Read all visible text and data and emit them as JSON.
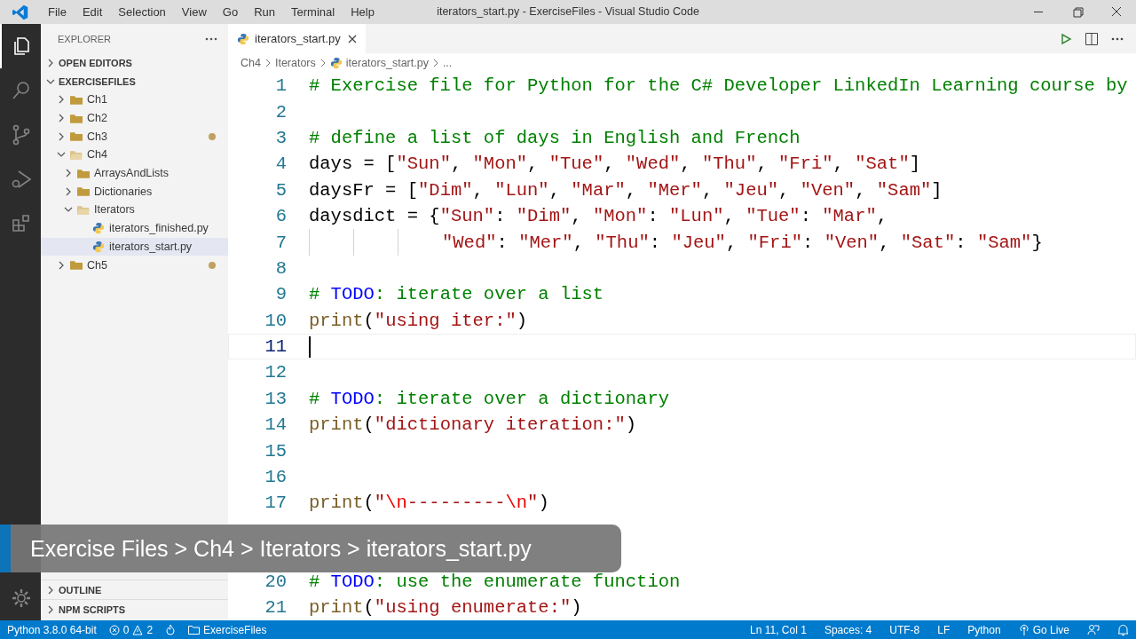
{
  "window": {
    "title": "iterators_start.py - ExerciseFiles - Visual Studio Code"
  },
  "menu": [
    "File",
    "Edit",
    "Selection",
    "View",
    "Go",
    "Run",
    "Terminal",
    "Help"
  ],
  "activity_bar": [
    {
      "kind": "explorer",
      "selected": true
    },
    {
      "kind": "search",
      "selected": false
    },
    {
      "kind": "source-control",
      "selected": false
    },
    {
      "kind": "run",
      "selected": false
    },
    {
      "kind": "extensions",
      "selected": false
    }
  ],
  "sidebar": {
    "title": "EXPLORER",
    "sections": [
      {
        "label": "OPEN EDITORS",
        "expanded": false
      },
      {
        "label": "EXERCISEFILES",
        "expanded": true
      }
    ],
    "tree": [
      {
        "kind": "folder",
        "label": "Ch1",
        "expanded": false,
        "modified": false,
        "selected": false
      },
      {
        "kind": "folder",
        "label": "Ch2",
        "expanded": false,
        "modified": false,
        "selected": false
      },
      {
        "kind": "folder",
        "label": "Ch3",
        "expanded": false,
        "modified": true,
        "selected": false
      },
      {
        "kind": "folder",
        "label": "Ch4",
        "expanded": true,
        "modified": false,
        "selected": false,
        "children": [
          {
            "kind": "folder",
            "label": "ArraysAndLists",
            "expanded": false,
            "modified": false,
            "selected": false
          },
          {
            "kind": "folder",
            "label": "Dictionaries",
            "expanded": false,
            "modified": false,
            "selected": false
          },
          {
            "kind": "folder",
            "label": "Iterators",
            "expanded": true,
            "modified": false,
            "selected": false,
            "children": [
              {
                "kind": "file",
                "label": "iterators_finished.py",
                "modified": false,
                "selected": false
              },
              {
                "kind": "file",
                "label": "iterators_start.py",
                "modified": false,
                "selected": true
              }
            ]
          }
        ]
      },
      {
        "kind": "folder",
        "label": "Ch5",
        "expanded": false,
        "modified": true,
        "selected": false
      }
    ],
    "bottom_sections": [
      {
        "label": "OUTLINE",
        "expanded": false
      },
      {
        "label": "NPM SCRIPTS",
        "expanded": false
      }
    ]
  },
  "tabs": [
    {
      "label": "iterators_start.py",
      "selected": true
    }
  ],
  "breadcrumbs": [
    {
      "kind": "folder",
      "label": "Ch4"
    },
    {
      "kind": "folder",
      "label": "Iterators"
    },
    {
      "kind": "file",
      "label": "iterators_start.py"
    },
    {
      "kind": "more",
      "label": "..."
    }
  ],
  "editor": {
    "lines": [
      {
        "number": "1",
        "kind": "code",
        "cursor": false,
        "tokens": [
          {
            "kind": "comment",
            "text": "# Exercise file for Python for the C# Developer LinkedIn Learning course by"
          }
        ]
      },
      {
        "number": "2",
        "kind": "code",
        "cursor": false
      },
      {
        "number": "3",
        "kind": "code",
        "cursor": false,
        "tokens": [
          {
            "kind": "comment",
            "text": "# define a list of days in English and French"
          }
        ]
      },
      {
        "number": "4",
        "kind": "code",
        "cursor": false,
        "tokens": [
          {
            "kind": "plain",
            "text": "days = ["
          },
          {
            "kind": "string",
            "text": "\"Sun\""
          },
          {
            "kind": "plain",
            "text": ", "
          },
          {
            "kind": "string",
            "text": "\"Mon\""
          },
          {
            "kind": "plain",
            "text": ", "
          },
          {
            "kind": "string",
            "text": "\"Tue\""
          },
          {
            "kind": "plain",
            "text": ", "
          },
          {
            "kind": "string",
            "text": "\"Wed\""
          },
          {
            "kind": "plain",
            "text": ", "
          },
          {
            "kind": "string",
            "text": "\"Thu\""
          },
          {
            "kind": "plain",
            "text": ", "
          },
          {
            "kind": "string",
            "text": "\"Fri\""
          },
          {
            "kind": "plain",
            "text": ", "
          },
          {
            "kind": "string",
            "text": "\"Sat\""
          },
          {
            "kind": "plain",
            "text": "]"
          }
        ]
      },
      {
        "number": "5",
        "kind": "code",
        "cursor": false,
        "tokens": [
          {
            "kind": "plain",
            "text": "daysFr = ["
          },
          {
            "kind": "string",
            "text": "\"Dim\""
          },
          {
            "kind": "plain",
            "text": ", "
          },
          {
            "kind": "string",
            "text": "\"Lun\""
          },
          {
            "kind": "plain",
            "text": ", "
          },
          {
            "kind": "string",
            "text": "\"Mar\""
          },
          {
            "kind": "plain",
            "text": ", "
          },
          {
            "kind": "string",
            "text": "\"Mer\""
          },
          {
            "kind": "plain",
            "text": ", "
          },
          {
            "kind": "string",
            "text": "\"Jeu\""
          },
          {
            "kind": "plain",
            "text": ", "
          },
          {
            "kind": "string",
            "text": "\"Ven\""
          },
          {
            "kind": "plain",
            "text": ", "
          },
          {
            "kind": "string",
            "text": "\"Sam\""
          },
          {
            "kind": "plain",
            "text": "]"
          }
        ]
      },
      {
        "number": "6",
        "kind": "code",
        "cursor": false,
        "tokens": [
          {
            "kind": "plain",
            "text": "daysdict = {"
          },
          {
            "kind": "string",
            "text": "\"Sun\""
          },
          {
            "kind": "plain",
            "text": ": "
          },
          {
            "kind": "string",
            "text": "\"Dim\""
          },
          {
            "kind": "plain",
            "text": ", "
          },
          {
            "kind": "string",
            "text": "\"Mon\""
          },
          {
            "kind": "plain",
            "text": ": "
          },
          {
            "kind": "string",
            "text": "\"Lun\""
          },
          {
            "kind": "plain",
            "text": ", "
          },
          {
            "kind": "string",
            "text": "\"Tue\""
          },
          {
            "kind": "plain",
            "text": ": "
          },
          {
            "kind": "string",
            "text": "\"Mar\""
          },
          {
            "kind": "plain",
            "text": ","
          }
        ]
      },
      {
        "number": "7",
        "kind": "continuation",
        "cursor": false,
        "tokens": [
          {
            "kind": "string",
            "text": "\"Wed\""
          },
          {
            "kind": "plain",
            "text": ": "
          },
          {
            "kind": "string",
            "text": "\"Mer\""
          },
          {
            "kind": "plain",
            "text": ", "
          },
          {
            "kind": "string",
            "text": "\"Thu\""
          },
          {
            "kind": "plain",
            "text": ": "
          },
          {
            "kind": "string",
            "text": "\"Jeu\""
          },
          {
            "kind": "plain",
            "text": ", "
          },
          {
            "kind": "string",
            "text": "\"Fri\""
          },
          {
            "kind": "plain",
            "text": ": "
          },
          {
            "kind": "string",
            "text": "\"Ven\""
          },
          {
            "kind": "plain",
            "text": ", "
          },
          {
            "kind": "string",
            "text": "\"Sat\""
          },
          {
            "kind": "plain",
            "text": ": "
          },
          {
            "kind": "string",
            "text": "\"Sam\""
          },
          {
            "kind": "plain",
            "text": "}"
          }
        ]
      },
      {
        "number": "8",
        "kind": "code",
        "cursor": false
      },
      {
        "number": "9",
        "kind": "code",
        "cursor": false,
        "tokens": [
          {
            "kind": "comment",
            "text": "# "
          },
          {
            "kind": "keyword",
            "text": "TODO"
          },
          {
            "kind": "comment",
            "text": ": iterate over a list"
          }
        ]
      },
      {
        "number": "10",
        "kind": "code",
        "cursor": false,
        "tokens": [
          {
            "kind": "function",
            "text": "print"
          },
          {
            "kind": "plain",
            "text": "("
          },
          {
            "kind": "string",
            "text": "\"using iter:\""
          },
          {
            "kind": "plain",
            "text": ")"
          }
        ]
      },
      {
        "number": "11",
        "kind": "code",
        "cursor": true
      },
      {
        "number": "12",
        "kind": "code",
        "cursor": false
      },
      {
        "number": "13",
        "kind": "code",
        "cursor": false,
        "tokens": [
          {
            "kind": "comment",
            "text": "# "
          },
          {
            "kind": "keyword",
            "text": "TODO"
          },
          {
            "kind": "comment",
            "text": ": iterate over a dictionary"
          }
        ]
      },
      {
        "number": "14",
        "kind": "code",
        "cursor": false,
        "tokens": [
          {
            "kind": "function",
            "text": "print"
          },
          {
            "kind": "plain",
            "text": "("
          },
          {
            "kind": "string",
            "text": "\"dictionary iteration:\""
          },
          {
            "kind": "plain",
            "text": ")"
          }
        ]
      },
      {
        "number": "15",
        "kind": "code",
        "cursor": false
      },
      {
        "number": "16",
        "kind": "code",
        "cursor": false
      },
      {
        "number": "17",
        "kind": "code",
        "cursor": false,
        "tokens": [
          {
            "kind": "function",
            "text": "print"
          },
          {
            "kind": "plain",
            "text": "("
          },
          {
            "kind": "string",
            "text": "\""
          },
          {
            "kind": "escape",
            "text": "\\n"
          },
          {
            "kind": "string",
            "text": "---------"
          },
          {
            "kind": "escape",
            "text": "\\n"
          },
          {
            "kind": "string",
            "text": "\""
          },
          {
            "kind": "plain",
            "text": ")"
          }
        ]
      },
      {
        "number": "20",
        "kind": "code",
        "cursor": false,
        "tokens": [
          {
            "kind": "comment",
            "text": "# "
          },
          {
            "kind": "keyword",
            "text": "TODO"
          },
          {
            "kind": "comment",
            "text": ": use the enumerate function"
          }
        ]
      },
      {
        "number": "21",
        "kind": "code",
        "cursor": false,
        "tokens": [
          {
            "kind": "function",
            "text": "print"
          },
          {
            "kind": "plain",
            "text": "("
          },
          {
            "kind": "string",
            "text": "\"using enumerate:\""
          },
          {
            "kind": "plain",
            "text": ")"
          }
        ]
      }
    ]
  },
  "overlay": {
    "text": "Exercise Files > Ch4 > Iterators > iterators_start.py"
  },
  "status_bar": {
    "interpreter": "Python 3.8.0 64-bit",
    "errors": "0",
    "warnings": "2",
    "folder": "ExerciseFiles",
    "position": "Ln 11, Col 1",
    "indent": "Spaces: 4",
    "encoding": "UTF-8",
    "eol": "LF",
    "language": "Python",
    "live": "Go Live"
  }
}
